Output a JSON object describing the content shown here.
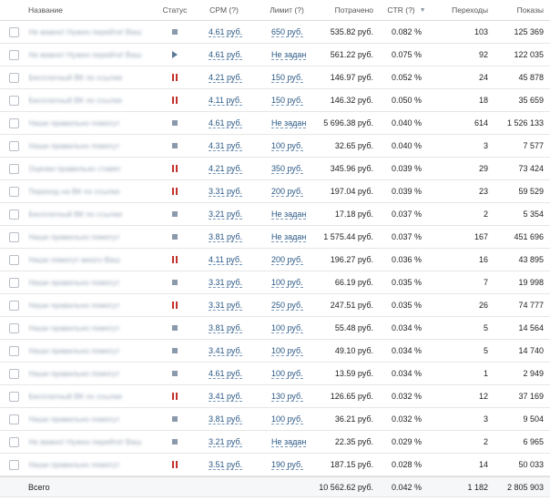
{
  "columns": {
    "name": "Название",
    "status": "Статус",
    "cpm": "CPM (?)",
    "limit": "Лимит (?)",
    "spent": "Потрачено",
    "ctr": "CTR (?)",
    "clicks": "Переходы",
    "shows": "Показы"
  },
  "ctr_sort_icon": "chevron-down-icon",
  "status_colors": {
    "active": "#8b99ac",
    "paused": "#c4302b",
    "playing": "#5b7a99"
  },
  "rows": [
    {
      "name": "Не важно! Нужно перейти! Ваш",
      "status": "active",
      "cpm": "4.61 руб.",
      "limit": "650 руб.",
      "spent": "535.82 руб.",
      "ctr": "0.082 %",
      "clicks": "103",
      "shows": "125 369"
    },
    {
      "name": "Не важно! Нужно перейти! Ваш",
      "status": "playing",
      "cpm": "4.61 руб.",
      "limit": "Не задан",
      "spent": "561.22 руб.",
      "ctr": "0.075 %",
      "clicks": "92",
      "shows": "122 035"
    },
    {
      "name": "Бесплатный ВК по ссылке",
      "status": "paused",
      "cpm": "4.21 руб.",
      "limit": "150 руб.",
      "spent": "146.97 руб.",
      "ctr": "0.052 %",
      "clicks": "24",
      "shows": "45 878"
    },
    {
      "name": "Бесплатный ВК по ссылке",
      "status": "paused",
      "cpm": "4.11 руб.",
      "limit": "150 руб.",
      "spent": "146.32 руб.",
      "ctr": "0.050 %",
      "clicks": "18",
      "shows": "35 659"
    },
    {
      "name": "Наши правильно помогут",
      "status": "active",
      "cpm": "4.61 руб.",
      "limit": "Не задан",
      "spent": "5 696.38 руб.",
      "ctr": "0.040 %",
      "clicks": "614",
      "shows": "1 526 133"
    },
    {
      "name": "Наши правильно помогут",
      "status": "active",
      "cpm": "4.31 руб.",
      "limit": "100 руб.",
      "spent": "32.65 руб.",
      "ctr": "0.040 %",
      "clicks": "3",
      "shows": "7 577"
    },
    {
      "name": "Оценки правильно ставят",
      "status": "paused",
      "cpm": "4.21 руб.",
      "limit": "350 руб.",
      "spent": "345.96 руб.",
      "ctr": "0.039 %",
      "clicks": "29",
      "shows": "73 424"
    },
    {
      "name": "Переход на ВК по ссылке",
      "status": "paused",
      "cpm": "3.31 руб.",
      "limit": "200 руб.",
      "spent": "197.04 руб.",
      "ctr": "0.039 %",
      "clicks": "23",
      "shows": "59 529"
    },
    {
      "name": "Бесплатный ВК по ссылке",
      "status": "active",
      "cpm": "3.21 руб.",
      "limit": "Не задан",
      "spent": "17.18 руб.",
      "ctr": "0.037 %",
      "clicks": "2",
      "shows": "5 354"
    },
    {
      "name": "Наши правильно помогут",
      "status": "active",
      "cpm": "3.81 руб.",
      "limit": "Не задан",
      "spent": "1 575.44 руб.",
      "ctr": "0.037 %",
      "clicks": "167",
      "shows": "451 696"
    },
    {
      "name": "Наши помогут много Ваш",
      "status": "paused",
      "cpm": "4.11 руб.",
      "limit": "200 руб.",
      "spent": "196.27 руб.",
      "ctr": "0.036 %",
      "clicks": "16",
      "shows": "43 895"
    },
    {
      "name": "Наши правильно помогут",
      "status": "active",
      "cpm": "3.31 руб.",
      "limit": "100 руб.",
      "spent": "66.19 руб.",
      "ctr": "0.035 %",
      "clicks": "7",
      "shows": "19 998"
    },
    {
      "name": "Наши правильно помогут",
      "status": "paused",
      "cpm": "3.31 руб.",
      "limit": "250 руб.",
      "spent": "247.51 руб.",
      "ctr": "0.035 %",
      "clicks": "26",
      "shows": "74 777"
    },
    {
      "name": "Наши правильно помогут",
      "status": "active",
      "cpm": "3.81 руб.",
      "limit": "100 руб.",
      "spent": "55.48 руб.",
      "ctr": "0.034 %",
      "clicks": "5",
      "shows": "14 564"
    },
    {
      "name": "Наши правильно помогут",
      "status": "active",
      "cpm": "3.41 руб.",
      "limit": "100 руб.",
      "spent": "49.10 руб.",
      "ctr": "0.034 %",
      "clicks": "5",
      "shows": "14 740"
    },
    {
      "name": "Наши правильно помогут",
      "status": "active",
      "cpm": "4.61 руб.",
      "limit": "100 руб.",
      "spent": "13.59 руб.",
      "ctr": "0.034 %",
      "clicks": "1",
      "shows": "2 949"
    },
    {
      "name": "Бесплатный ВК по ссылке",
      "status": "paused",
      "cpm": "3.41 руб.",
      "limit": "130 руб.",
      "spent": "126.65 руб.",
      "ctr": "0.032 %",
      "clicks": "12",
      "shows": "37 169"
    },
    {
      "name": "Наши правильно помогут",
      "status": "active",
      "cpm": "3.81 руб.",
      "limit": "100 руб.",
      "spent": "36.21 руб.",
      "ctr": "0.032 %",
      "clicks": "3",
      "shows": "9 504"
    },
    {
      "name": "Не важно! Нужно перейти! Ваш",
      "status": "active",
      "cpm": "3.21 руб.",
      "limit": "Не задан",
      "spent": "22.35 руб.",
      "ctr": "0.029 %",
      "clicks": "2",
      "shows": "6 965"
    },
    {
      "name": "Наши правильно помогут",
      "status": "paused",
      "cpm": "3.51 руб.",
      "limit": "190 руб.",
      "spent": "187.15 руб.",
      "ctr": "0.028 %",
      "clicks": "14",
      "shows": "50 033"
    }
  ],
  "totals": {
    "label": "Всего",
    "spent": "10 562.62 руб.",
    "ctr": "0.042 %",
    "clicks": "1 182",
    "shows": "2 805 903"
  }
}
